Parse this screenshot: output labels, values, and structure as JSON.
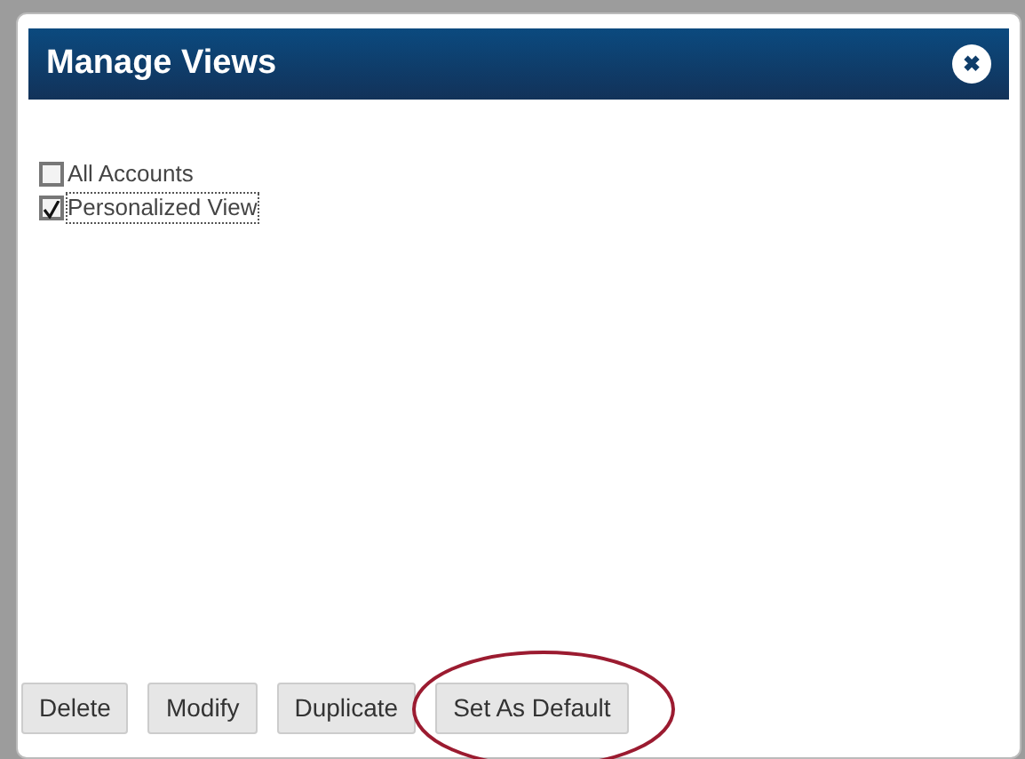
{
  "dialog": {
    "title": "Manage Views",
    "close": "✖"
  },
  "views": [
    {
      "label": "All Accounts",
      "checked": false,
      "focused": false
    },
    {
      "label": "Personalized View",
      "checked": true,
      "focused": true
    }
  ],
  "buttons": [
    {
      "label": "Delete",
      "circled": false
    },
    {
      "label": "Modify",
      "circled": false
    },
    {
      "label": "Duplicate",
      "circled": false
    },
    {
      "label": "Set As Default",
      "circled": true
    }
  ]
}
